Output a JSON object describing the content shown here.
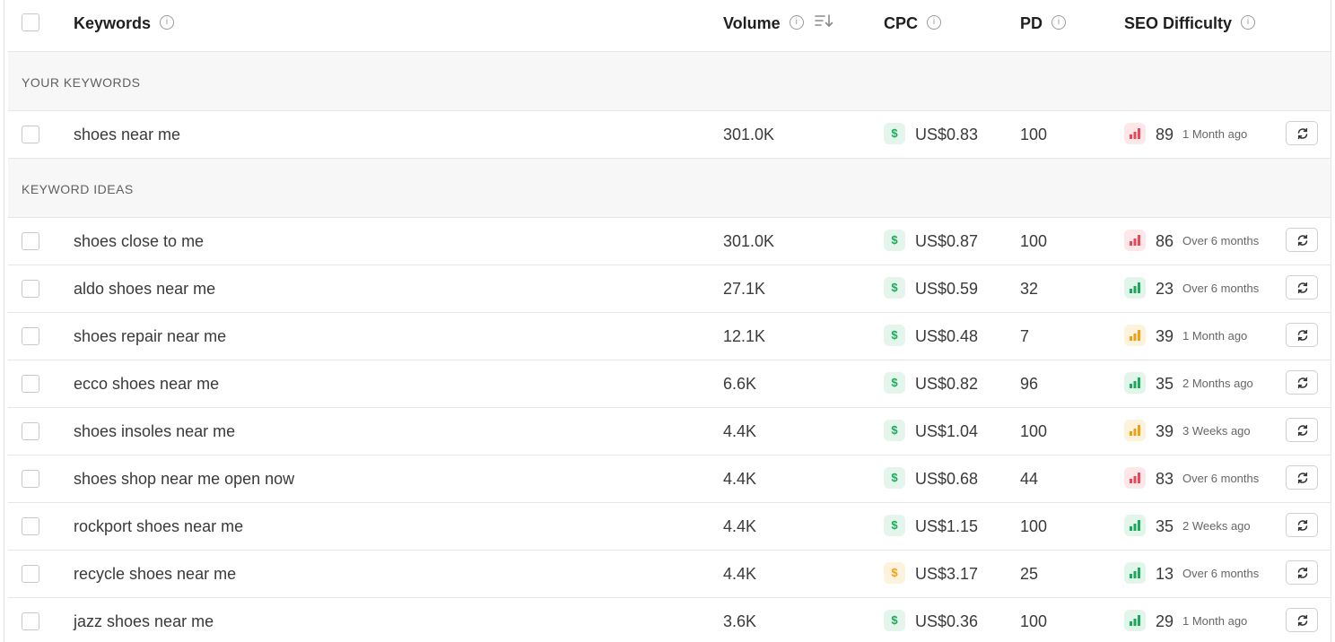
{
  "header": {
    "keywords": "Keywords",
    "volume": "Volume",
    "cpc": "CPC",
    "pd": "PD",
    "seo": "SEO Difficulty"
  },
  "sections": {
    "your_keywords": "YOUR KEYWORDS",
    "keyword_ideas": "KEYWORD IDEAS"
  },
  "colors": {
    "green": "#1aaa5c",
    "amber": "#f0a012",
    "red": "#ef4656"
  },
  "your_keywords": [
    {
      "keyword": "shoes near me",
      "volume": "301.0K",
      "cpc": "US$0.83",
      "cpc_level": "green",
      "pd": "100",
      "seo": "89",
      "seo_level": "red",
      "updated": "1 Month ago"
    }
  ],
  "keyword_ideas": [
    {
      "keyword": "shoes close to me",
      "volume": "301.0K",
      "cpc": "US$0.87",
      "cpc_level": "green",
      "pd": "100",
      "seo": "86",
      "seo_level": "red",
      "updated": "Over 6 months"
    },
    {
      "keyword": "aldo shoes near me",
      "volume": "27.1K",
      "cpc": "US$0.59",
      "cpc_level": "green",
      "pd": "32",
      "seo": "23",
      "seo_level": "green",
      "updated": "Over 6 months"
    },
    {
      "keyword": "shoes repair near me",
      "volume": "12.1K",
      "cpc": "US$0.48",
      "cpc_level": "green",
      "pd": "7",
      "seo": "39",
      "seo_level": "amber",
      "updated": "1 Month ago"
    },
    {
      "keyword": "ecco shoes near me",
      "volume": "6.6K",
      "cpc": "US$0.82",
      "cpc_level": "green",
      "pd": "96",
      "seo": "35",
      "seo_level": "green",
      "updated": "2 Months ago"
    },
    {
      "keyword": "shoes insoles near me",
      "volume": "4.4K",
      "cpc": "US$1.04",
      "cpc_level": "green",
      "pd": "100",
      "seo": "39",
      "seo_level": "amber",
      "updated": "3 Weeks ago"
    },
    {
      "keyword": "shoes shop near me open now",
      "volume": "4.4K",
      "cpc": "US$0.68",
      "cpc_level": "green",
      "pd": "44",
      "seo": "83",
      "seo_level": "red",
      "updated": "Over 6 months"
    },
    {
      "keyword": "rockport shoes near me",
      "volume": "4.4K",
      "cpc": "US$1.15",
      "cpc_level": "green",
      "pd": "100",
      "seo": "35",
      "seo_level": "green",
      "updated": "2 Weeks ago"
    },
    {
      "keyword": "recycle shoes near me",
      "volume": "4.4K",
      "cpc": "US$3.17",
      "cpc_level": "amber",
      "pd": "25",
      "seo": "13",
      "seo_level": "green",
      "updated": "Over 6 months"
    },
    {
      "keyword": "jazz shoes near me",
      "volume": "3.6K",
      "cpc": "US$0.36",
      "cpc_level": "green",
      "pd": "100",
      "seo": "29",
      "seo_level": "green",
      "updated": "1 Month ago"
    }
  ]
}
